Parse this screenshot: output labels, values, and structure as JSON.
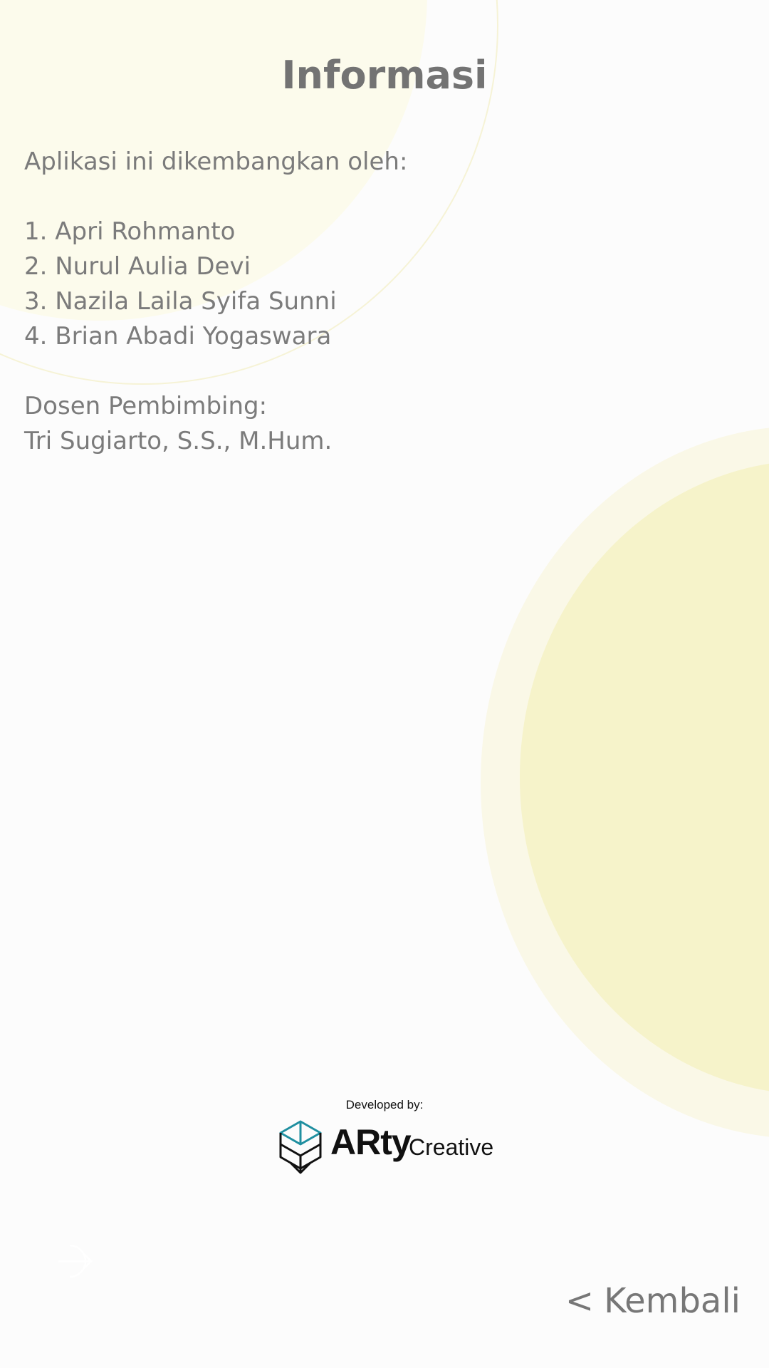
{
  "header": {
    "title": "Informasi"
  },
  "info": {
    "intro": "Aplikasi ini dikembangkan oleh:",
    "developers": [
      "1. Apri Rohmanto",
      "2. Nurul Aulia Devi",
      "3. Nazila Laila Syifa Sunni",
      "4. Brian Abadi Yogaswara"
    ],
    "supervisor_label": "Dosen Pembimbing:",
    "supervisor_name": "Tri Sugiarto, S.S., M.Hum."
  },
  "footer": {
    "developed_by": "Developed by:",
    "logo_primary": "ARty",
    "logo_secondary": "Creative",
    "logo_icon": "cube-icon",
    "login_icon": "login-icon"
  },
  "navigation": {
    "back_chevron": "<",
    "back_label": "Kembali"
  },
  "colors": {
    "background": "#fcfcfc",
    "text": "#7b7b7b",
    "accent_yellow": "#f6f3ca",
    "logo_teal": "#1f8fa0"
  }
}
